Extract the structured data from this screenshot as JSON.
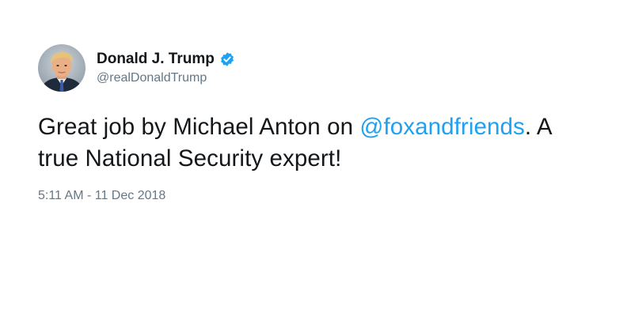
{
  "tweet": {
    "author": {
      "display_name": "Donald J. Trump",
      "handle": "@realDonaldTrump",
      "verified": true,
      "avatar_icon": "profile-photo-icon",
      "verified_icon": "verified-badge-icon"
    },
    "text_parts": {
      "before_mention": "Great job by Michael Anton on ",
      "mention": "@foxandfriends",
      "after_mention": ". A true National Security expert!"
    },
    "timestamp": "5:11 AM - 11 Dec 2018"
  },
  "colors": {
    "link": "#1da1f2",
    "secondary_text": "#657786",
    "primary_text": "#14171a",
    "verified_badge": "#1da1f2"
  }
}
